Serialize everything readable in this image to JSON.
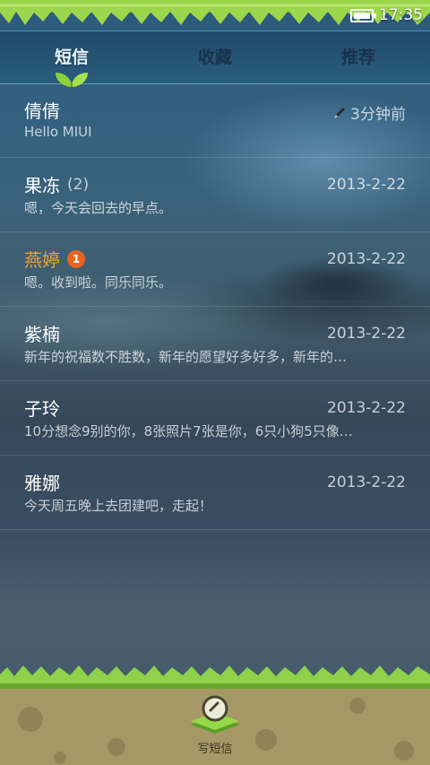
{
  "status_bar": {
    "time": "17:35",
    "battery_icon": "battery-icon"
  },
  "tabs": [
    {
      "label": "短信",
      "active": true
    },
    {
      "label": "收藏",
      "active": false
    },
    {
      "label": "推荐",
      "active": false
    }
  ],
  "conversations": [
    {
      "name": "倩倩",
      "count": "",
      "badge": "",
      "time": "3分钟前",
      "draft_icon": "pencil-icon",
      "preview": "Hello MIUI",
      "unread": false
    },
    {
      "name": "果冻",
      "count": "(2)",
      "badge": "",
      "time": "2013-2-22",
      "preview": "嗯，今天会回去的早点。",
      "unread": false
    },
    {
      "name": "燕婷",
      "count": "",
      "badge": "1",
      "time": "2013-2-22",
      "preview": "嗯。收到啦。同乐同乐。",
      "unread": true
    },
    {
      "name": "紫楠",
      "count": "",
      "badge": "",
      "time": "2013-2-22",
      "preview": "新年的祝福数不胜数，新年的愿望好多好多，新年的…",
      "unread": false
    },
    {
      "name": "子玲",
      "count": "",
      "badge": "",
      "time": "2013-2-22",
      "preview": "10分想念9别的你，8张照片7张是你，6只小狗5只像…",
      "unread": false
    },
    {
      "name": "雅娜",
      "count": "",
      "badge": "",
      "time": "2013-2-22",
      "preview": "今天周五晚上去团建吧，走起！",
      "unread": false
    }
  ],
  "compose": {
    "label": "写短信",
    "icon": "compose-icon"
  },
  "colors": {
    "accent_unread": "#f5a130",
    "badge": "#e8641e",
    "grass": "#8cc63f",
    "ground": "#a59866"
  }
}
